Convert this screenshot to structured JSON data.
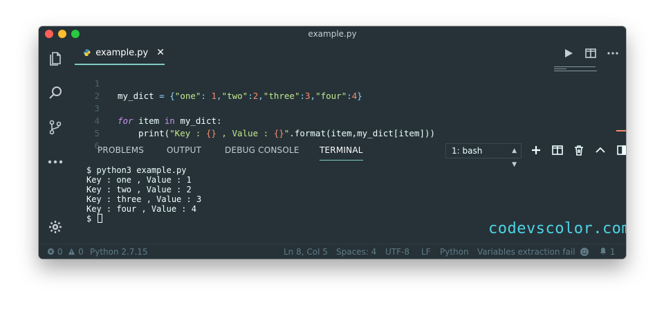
{
  "window": {
    "title": "example.py"
  },
  "editor_tab": {
    "label": "example.py",
    "close": "✕"
  },
  "code_lines": [
    {
      "num": "1"
    },
    {
      "num": "2"
    },
    {
      "num": "3"
    },
    {
      "num": "4"
    },
    {
      "num": "5"
    },
    {
      "num": "6"
    }
  ],
  "code": {
    "l1_var": "my_dict",
    "l1_eq": " = ",
    "l1_open": "{",
    "l1_k1": "\"one\"",
    "l1_c1": ": ",
    "l1_v1": "1",
    "l1_s1": ",",
    "l1_k2": "\"two\"",
    "l1_c2": ":",
    "l1_v2": "2",
    "l1_s2": ",",
    "l1_k3": "\"three\"",
    "l1_c3": ":",
    "l1_v3": "3",
    "l1_s3": ",",
    "l1_k4": "\"four\"",
    "l1_c4": ":",
    "l1_v4": "4",
    "l1_close": "}",
    "l3_for": "for",
    "l3_item": " item ",
    "l3_in": "in",
    "l3_rest": " my_dict:",
    "l4_print": "print(",
    "l4_str1": "\"Key : ",
    "l4_br1": "{}",
    "l4_str2": " , Value : ",
    "l4_br2": "{}",
    "l4_str3": "\"",
    "l4_rest": ".format(item,my_dict[item]))"
  },
  "panel": {
    "tabs": [
      "PROBLEMS",
      "OUTPUT",
      "DEBUG CONSOLE",
      "TERMINAL"
    ],
    "active_tab": "TERMINAL",
    "terminal_select": "1: bash"
  },
  "terminal": {
    "lines": [
      "$ python3 example.py",
      "Key : one , Value : 1",
      "Key : two , Value : 2",
      "Key : three , Value : 3",
      "Key : four , Value : 4"
    ],
    "prompt": "$ "
  },
  "watermark": "codevscolor.com",
  "status": {
    "errors": "0",
    "warnings": "0",
    "interpreter": "Python 2.7.15",
    "cursor": "Ln 8, Col 5",
    "spaces": "Spaces: 4",
    "encoding": "UTF-8",
    "eol": "LF",
    "language": "Python",
    "message": "Variables extraction fail",
    "notifications": "1"
  },
  "colors": {
    "background": "#263238",
    "accent": "#80cbc4",
    "keyword": "#c792ea",
    "string": "#c3e88d",
    "number": "#f78c6c",
    "watermark": "#4fd3e4"
  },
  "icons": {
    "activity": [
      "files-icon",
      "search-icon",
      "source-control-icon",
      "more-icon",
      "gear-icon"
    ],
    "editor_actions": [
      "run-icon",
      "split-editor-icon",
      "more-actions-icon"
    ],
    "panel_actions": [
      "add-terminal-icon",
      "split-terminal-icon",
      "trash-icon",
      "maximize-icon",
      "toggle-panel-icon",
      "close-icon"
    ]
  }
}
